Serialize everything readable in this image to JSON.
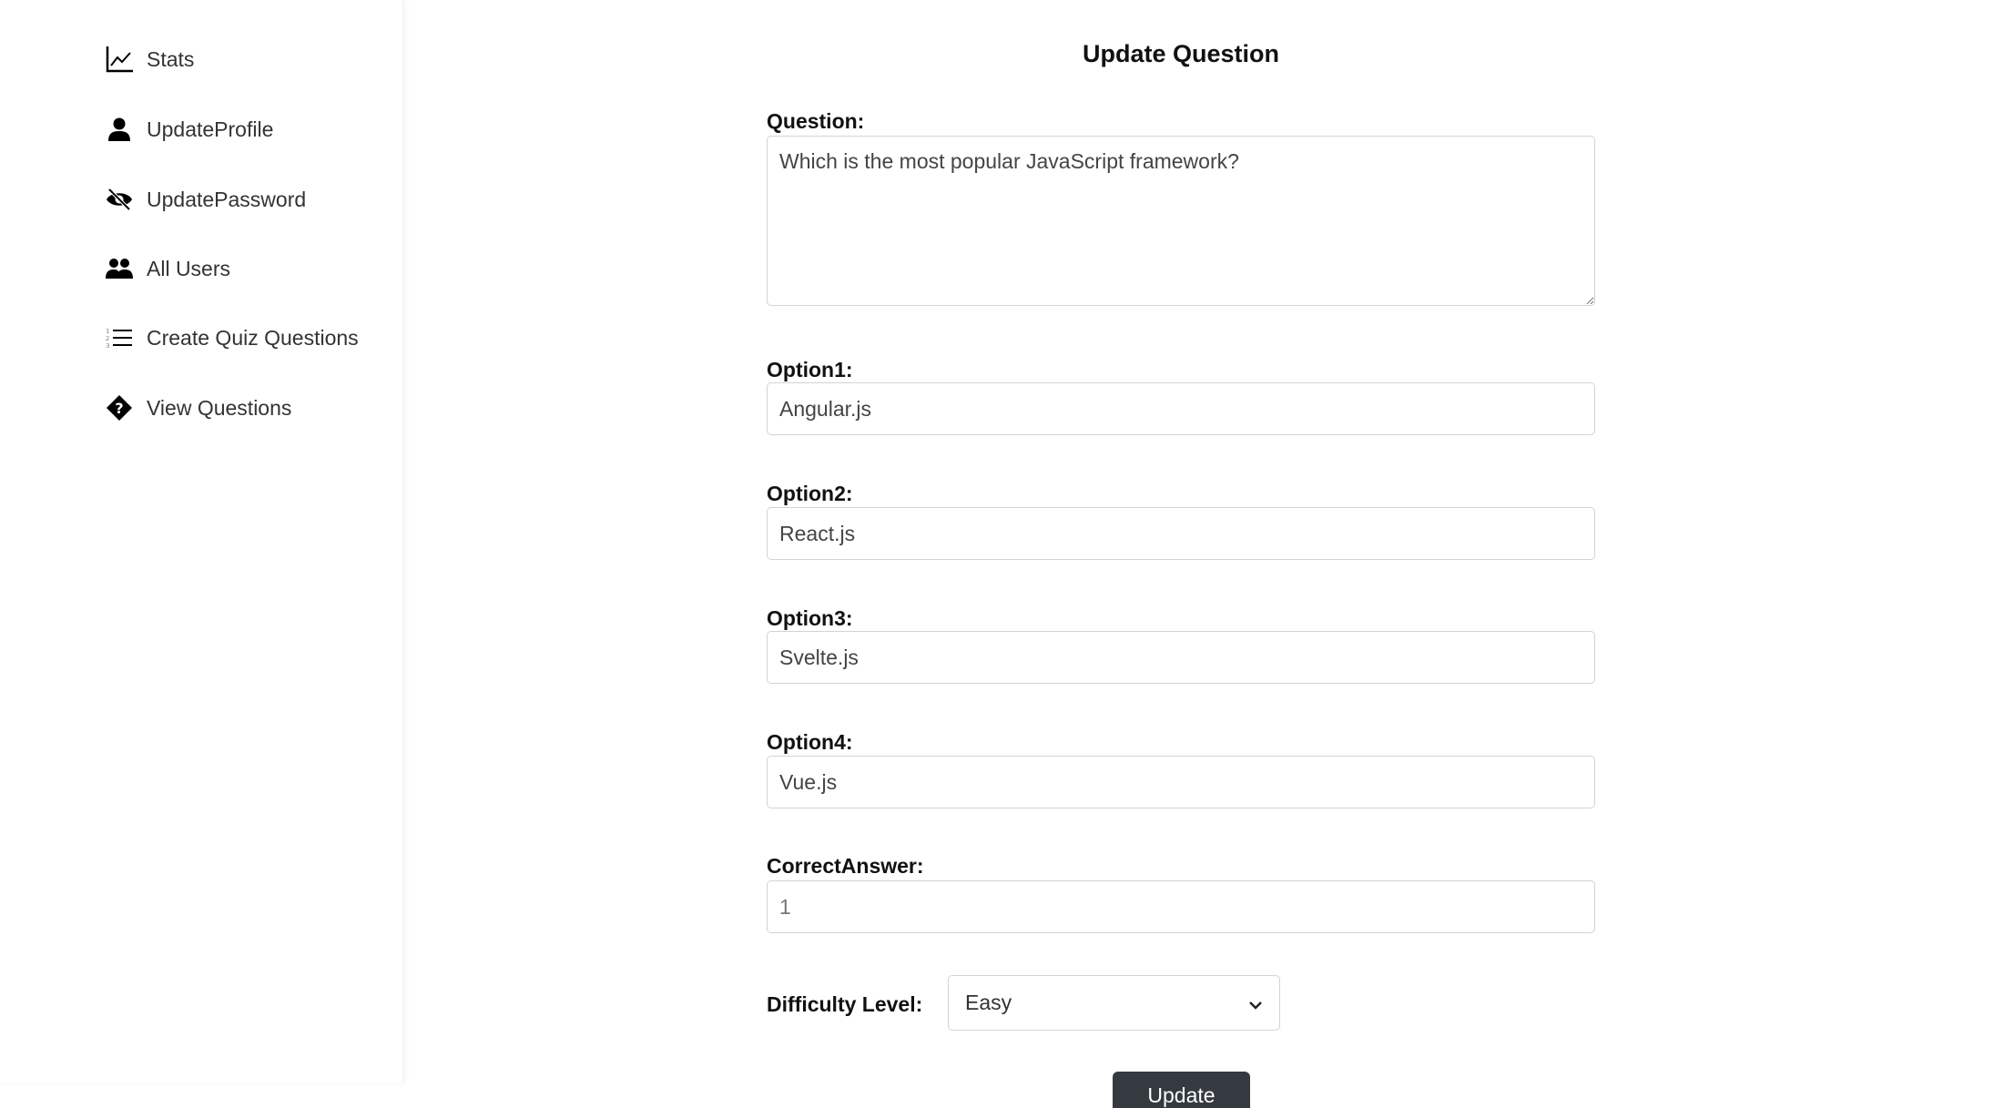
{
  "sidebar": {
    "items": [
      {
        "label": "Stats",
        "icon": "chart-line-icon"
      },
      {
        "label": "UpdateProfile",
        "icon": "user-icon"
      },
      {
        "label": "UpdatePassword",
        "icon": "eye-slash-icon"
      },
      {
        "label": "All Users",
        "icon": "users-icon"
      },
      {
        "label": "Create Quiz Questions",
        "icon": "list-ol-icon"
      },
      {
        "label": "View Questions",
        "icon": "question-diamond-icon"
      }
    ]
  },
  "form": {
    "title": "Update Question",
    "question_label": "Question:",
    "question_value": "Which is the most popular JavaScript framework?",
    "option1_label": "Option1:",
    "option1_value": "Angular.js",
    "option2_label": "Option2:",
    "option2_value": "React.js",
    "option3_label": "Option3:",
    "option3_value": "Svelte.js",
    "option4_label": "Option4:",
    "option4_value": "Vue.js",
    "correct_label": "CorrectAnswer:",
    "correct_value": "1",
    "difficulty_label": "Difficulty Level:",
    "difficulty_value": "Easy",
    "submit_label": "Update"
  }
}
